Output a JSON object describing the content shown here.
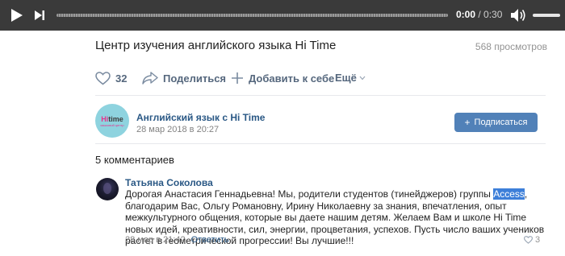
{
  "player": {
    "current_time": "0:00",
    "separator": " / ",
    "total_time": "0:30",
    "progress": 0
  },
  "video": {
    "title": "Центр изучения английского языка Hi Time",
    "views": "568 просмотров"
  },
  "actions": {
    "like_count": "32",
    "share_label": "Поделиться",
    "add_label": "Добавить к себе",
    "more_label": "Ещё"
  },
  "channel": {
    "name": "Английский язык с Hi Time",
    "date": "28 мар 2018 в 20:27",
    "subscribe_label": "Подписаться",
    "avatar_logo": {
      "hi": "Hi",
      "time": "time",
      "sub": "языковой центр"
    }
  },
  "comments": {
    "count_label": "5 комментариев",
    "items": [
      {
        "author": "Татьяна Соколова",
        "text_before": "Дорогая Анастасия Геннадьевна! Мы, родители студентов (тинейджеров) группы ",
        "highlight": "Access",
        "text_after": ", благодарим Вас, Ольгу Романовну, Ирину Николаевну за знания, впечатления, опыт межкультурного общения, которые вы даете нашим детям. Желаем Вам и школе Hi Time новых идей, креативности, сил, энергии, процветания, успехов. Пусть число ваших учеников растет в геометрической прогрессии! Вы лучшие!!!",
        "date": "28 мар в 21:42",
        "reply_label": "Ответить",
        "likes": "3"
      }
    ]
  },
  "colors": {
    "player_bg": "#3a3a3a",
    "link": "#2a5885",
    "button": "#5181b8",
    "highlight": "#3d7fd9",
    "muted": "#828282"
  },
  "icons": [
    "play-icon",
    "next-icon",
    "volume-icon",
    "heart-icon",
    "share-icon",
    "plus-icon",
    "chevron-down-icon"
  ]
}
